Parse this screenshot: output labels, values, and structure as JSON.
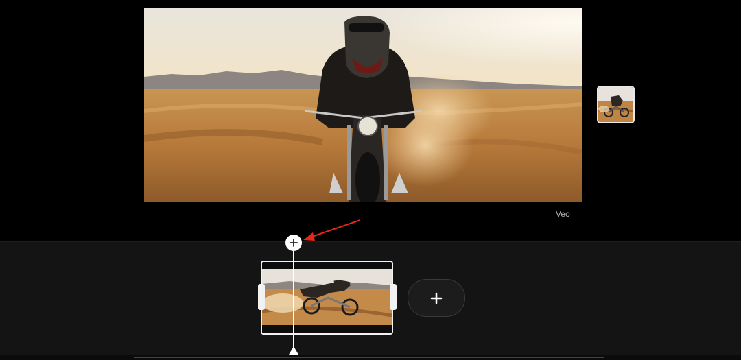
{
  "viewer": {
    "watermark": "Veo",
    "main_frame_icon": "trex-motorcycle-desert-scene",
    "side_thumbnail_icon": "trex-motorcycle-thumbnail"
  },
  "timeline": {
    "clip_thumbnail_icon": "trex-motorcycle-clip",
    "add_clip_icon": "plus-icon",
    "playhead_plus_icon": "plus-icon"
  },
  "annotation": {
    "arrow_color": "#e8271b"
  },
  "colors": {
    "background": "#000000",
    "timeline_background": "#141414",
    "accent_white": "#ffffff"
  }
}
